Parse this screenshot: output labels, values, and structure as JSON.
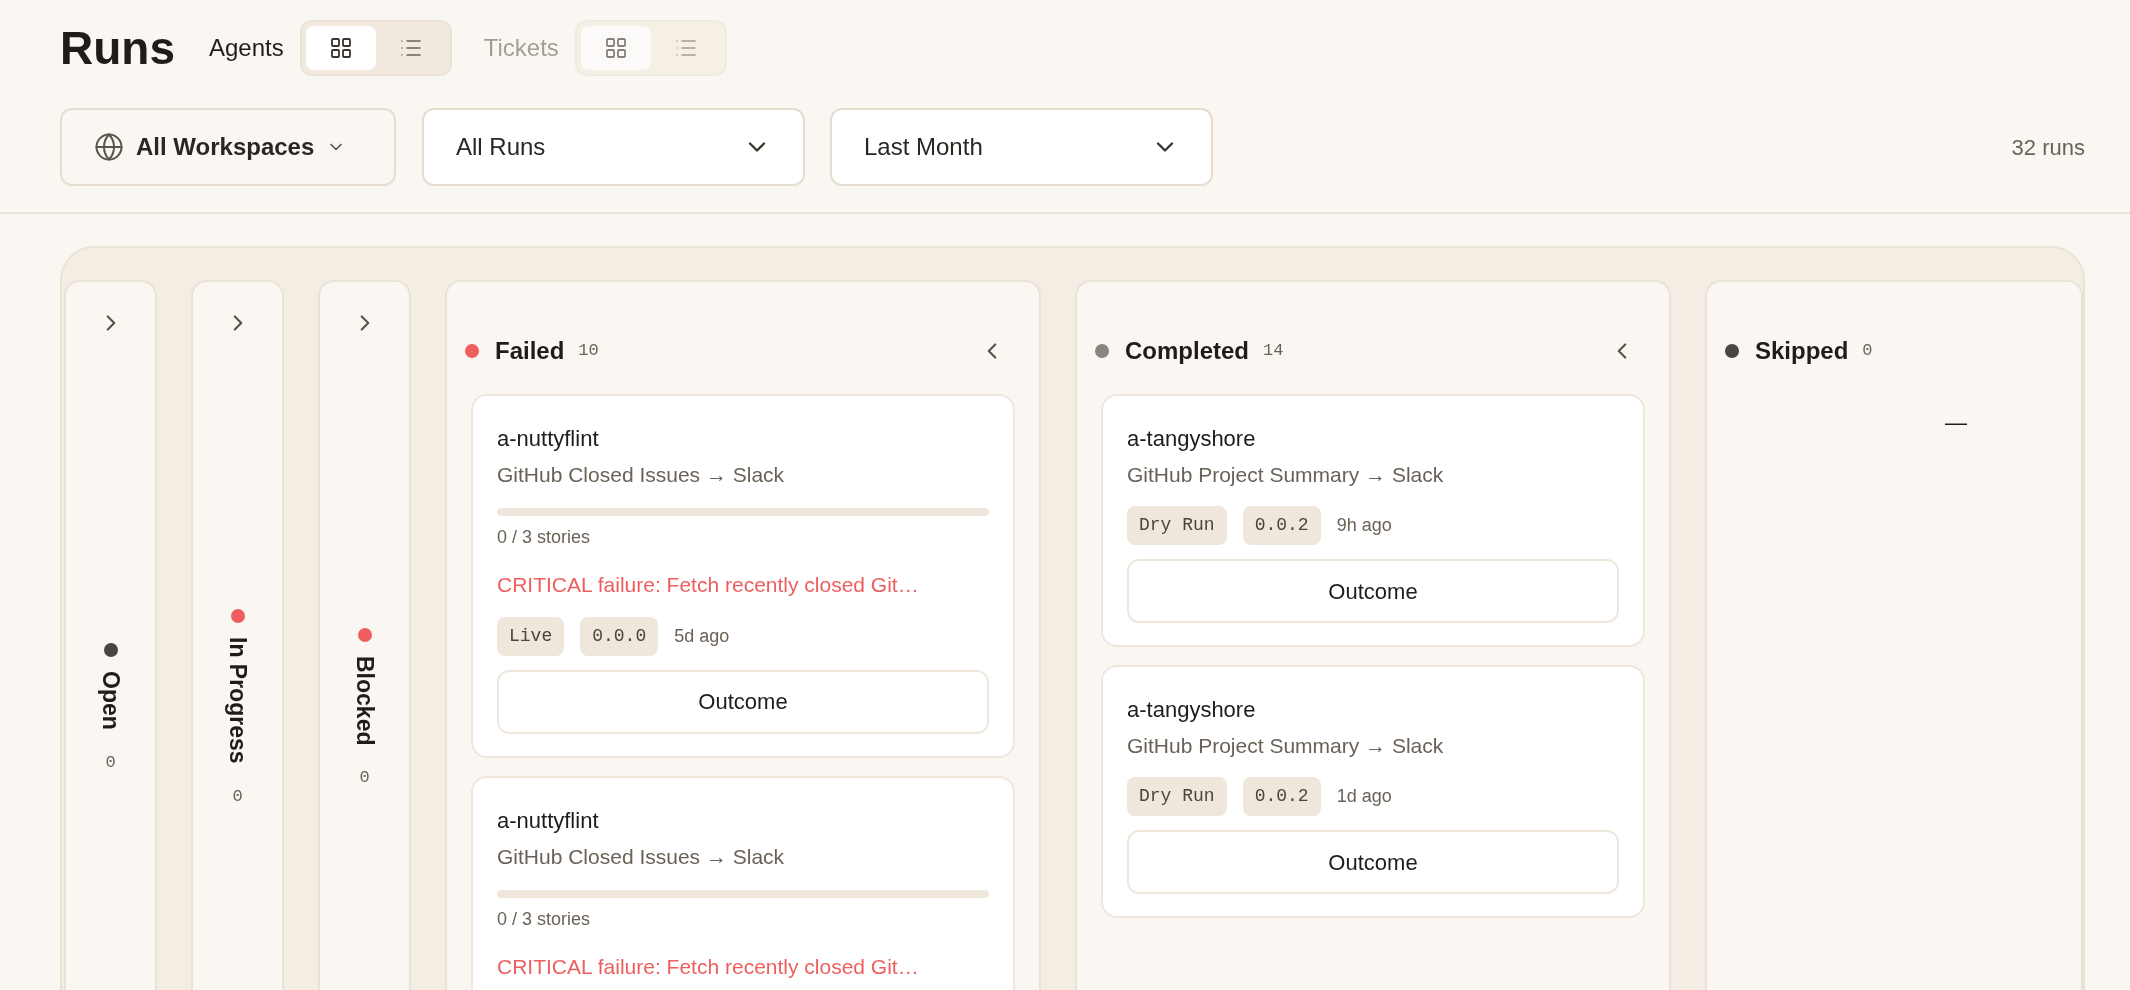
{
  "page_title": "Runs",
  "view_groups": [
    {
      "label": "Agents",
      "disabled": false,
      "options": [
        {
          "kind": "grid",
          "selected": true
        },
        {
          "kind": "list",
          "selected": false
        }
      ]
    },
    {
      "label": "Tickets",
      "disabled": true,
      "options": [
        {
          "kind": "grid",
          "selected": true
        },
        {
          "kind": "list",
          "selected": false
        }
      ]
    }
  ],
  "filters": [
    {
      "kind": "workspace",
      "value": "All Workspaces"
    },
    {
      "kind": "select",
      "value": "All Runs"
    },
    {
      "kind": "select",
      "value": "Last Month"
    }
  ],
  "run_count": "32 runs",
  "columns": [
    {
      "title": "Open",
      "count": "0",
      "color": "#4a4540",
      "expanded": false
    },
    {
      "title": "In Progress",
      "count": "0",
      "color": "#ef5e5e",
      "expanded": false
    },
    {
      "title": "Blocked",
      "count": "0",
      "color": "#ef5e5e",
      "expanded": false
    },
    {
      "title": "Failed",
      "count": "10",
      "color": "#ef5e5e",
      "expanded": true,
      "cards": [
        {
          "name": "a-nuttyflint",
          "workflow": "GitHub Closed Issues → Slack",
          "level": 0,
          "stories": "0 / 3 stories",
          "error": "CRITICAL failure: Fetch recently closed Git…",
          "badges": [
            "Live",
            "0.0.0"
          ],
          "time": "5d ago",
          "button": "Outcome"
        },
        {
          "name": "a-nuttyflint",
          "workflow": "GitHub Closed Issues → Slack",
          "level": 0,
          "stories": "0 / 3 stories",
          "error": "CRITICAL failure: Fetch recently closed Git…"
        }
      ]
    },
    {
      "title": "Completed",
      "count": "14",
      "color": "#8a857f",
      "expanded": true,
      "cards": [
        {
          "name": "a-tangyshore",
          "workflow": "GitHub Project Summary → Slack",
          "badges": [
            "Dry Run",
            "0.0.2"
          ],
          "time": "9h ago",
          "button": "Outcome"
        },
        {
          "name": "a-tangyshore",
          "workflow": "GitHub Project Summary → Slack",
          "badges": [
            "Dry Run",
            "0.0.2"
          ],
          "time": "1d ago",
          "button": "Outcome"
        }
      ]
    },
    {
      "title": "Skipped",
      "count": "0",
      "color": "#4a4540",
      "expanded": true,
      "empty_text": "—"
    }
  ]
}
